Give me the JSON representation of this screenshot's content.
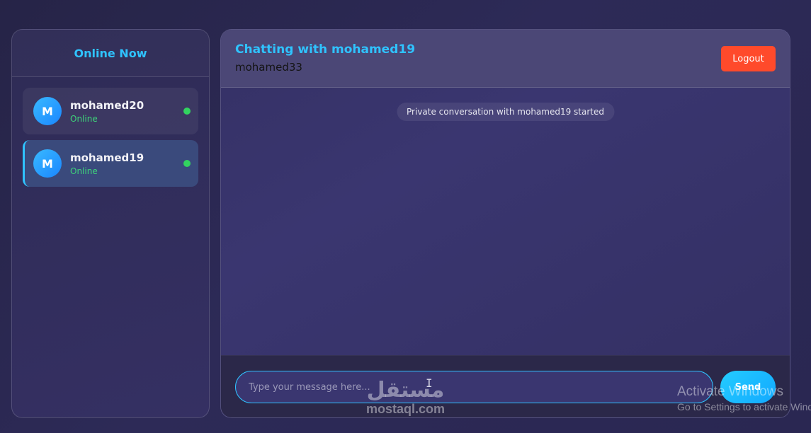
{
  "sidebar": {
    "title": "Online Now",
    "users": [
      {
        "avatar_letter": "M",
        "name": "mohamed20",
        "status": "Online",
        "active": false
      },
      {
        "avatar_letter": "M",
        "name": "mohamed19",
        "status": "Online",
        "active": true
      }
    ]
  },
  "chat": {
    "title": "Chatting with mohamed19",
    "current_user": "mohamed33",
    "logout_label": "Logout",
    "system_message": "Private conversation with mohamed19 started",
    "input_placeholder": "Type your message here...",
    "send_label": "Send"
  },
  "watermarks": {
    "activate_title": "Activate Windows",
    "activate_sub": "Go to Settings to activate Windows.",
    "brand_arabic": "مستقل",
    "brand_latin": "mostaql.com"
  },
  "colors": {
    "accent": "#2fc3ff",
    "logout": "#ff4a2b",
    "online": "#32d35f"
  },
  "icons": {
    "online_indicator": "green-dot",
    "text_cursor": "i-beam-cursor"
  }
}
